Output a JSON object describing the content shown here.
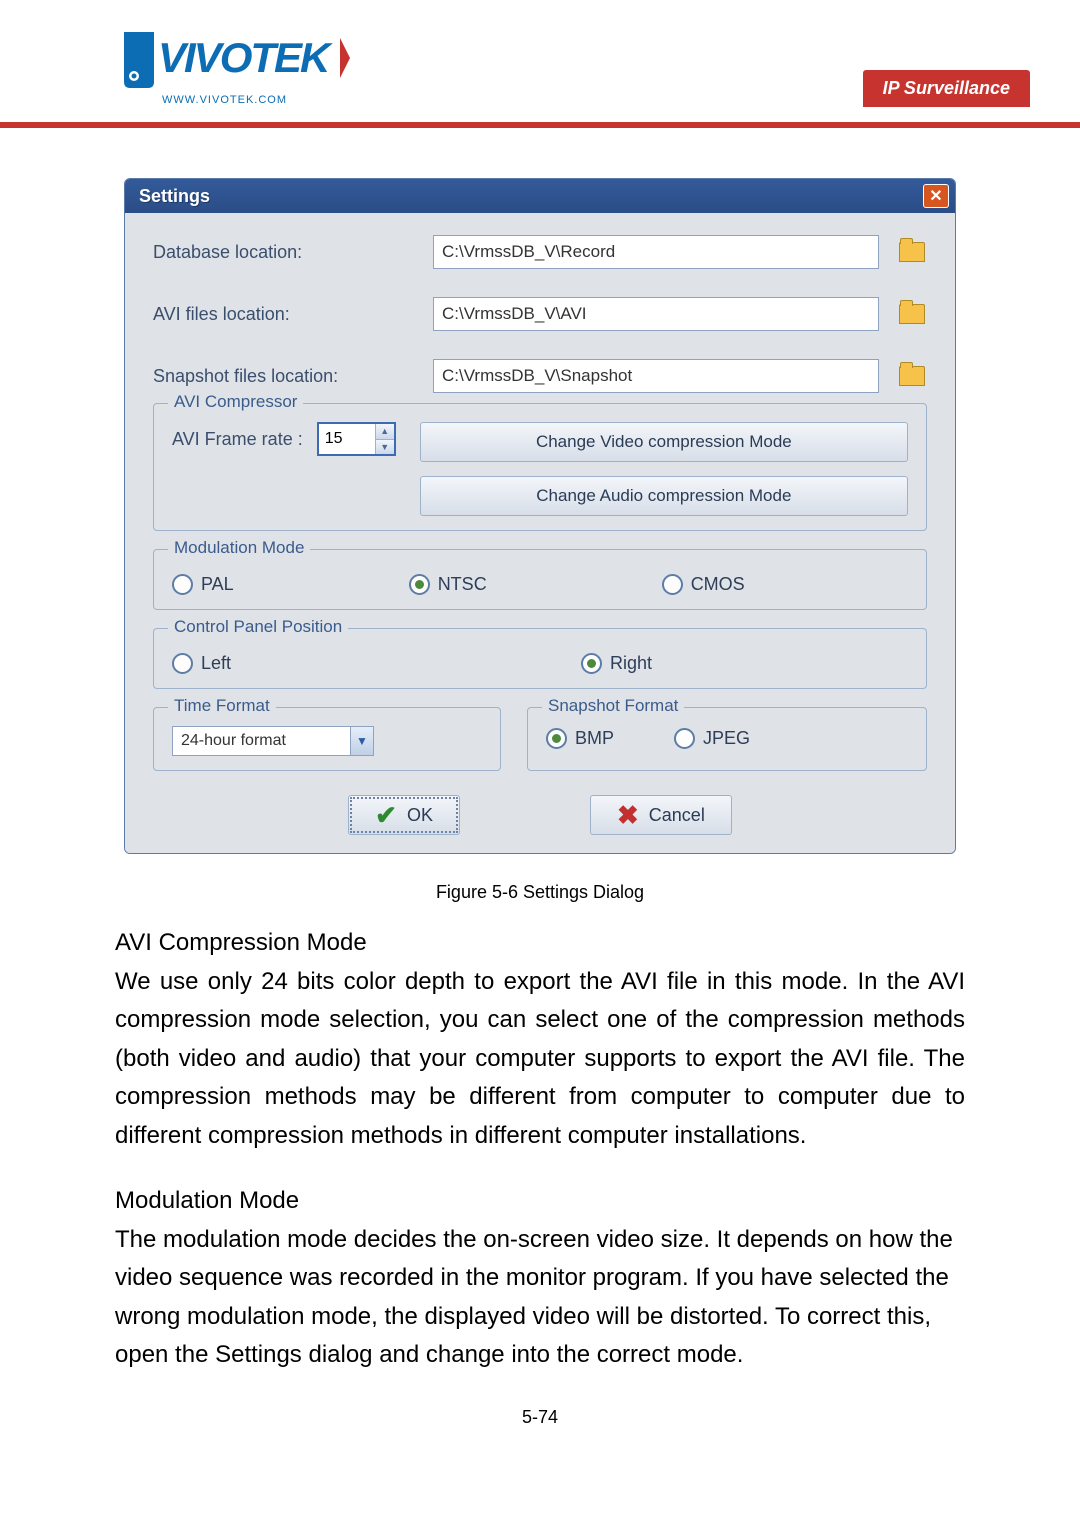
{
  "header": {
    "ip_surveillance": "IP Surveillance",
    "brand_sub": "WWW.VIVOTEK.COM"
  },
  "dialog": {
    "title": "Settings",
    "db_label": "Database location:",
    "db_value": "C:\\VrmssDB_V\\Record",
    "avi_label": "AVI files location:",
    "avi_value": "C:\\VrmssDB_V\\AVI",
    "snap_label": "Snapshot files location:",
    "snap_value": "C:\\VrmssDB_V\\Snapshot",
    "avi_group": "AVI Compressor",
    "avi_frame_label": "AVI Frame rate :",
    "avi_frame_value": "15",
    "btn_video": "Change Video compression Mode",
    "btn_audio": "Change Audio compression Mode",
    "mod_group": "Modulation Mode",
    "mod_pal": "PAL",
    "mod_ntsc": "NTSC",
    "mod_cmos": "CMOS",
    "cpp_group": "Control Panel Position",
    "cpp_left": "Left",
    "cpp_right": "Right",
    "time_group": "Time Format",
    "time_value": "24-hour format",
    "snapfmt_group": "Snapshot Format",
    "snapfmt_bmp": "BMP",
    "snapfmt_jpeg": "JPEG",
    "ok": "OK",
    "cancel": "Cancel"
  },
  "caption": "Figure 5-6 Settings Dialog",
  "sections": {
    "avi_head": "AVI Compression Mode",
    "avi_para": "We use only 24 bits color depth to export the AVI file in this mode. In the AVI compression mode selection, you can select one of the compression methods (both video and audio) that your computer supports to export the AVI file. The compression methods may be different from computer to computer due to different compression methods in different computer installations.",
    "mod_head": "Modulation Mode",
    "mod_para": "The modulation mode decides the on-screen video size. It depends on how the video sequence was recorded in the monitor program. If you have selected the wrong modulation mode, the displayed video will be distorted. To correct this, open the Settings dialog and change into the correct mode."
  },
  "pagenum": "5-74"
}
